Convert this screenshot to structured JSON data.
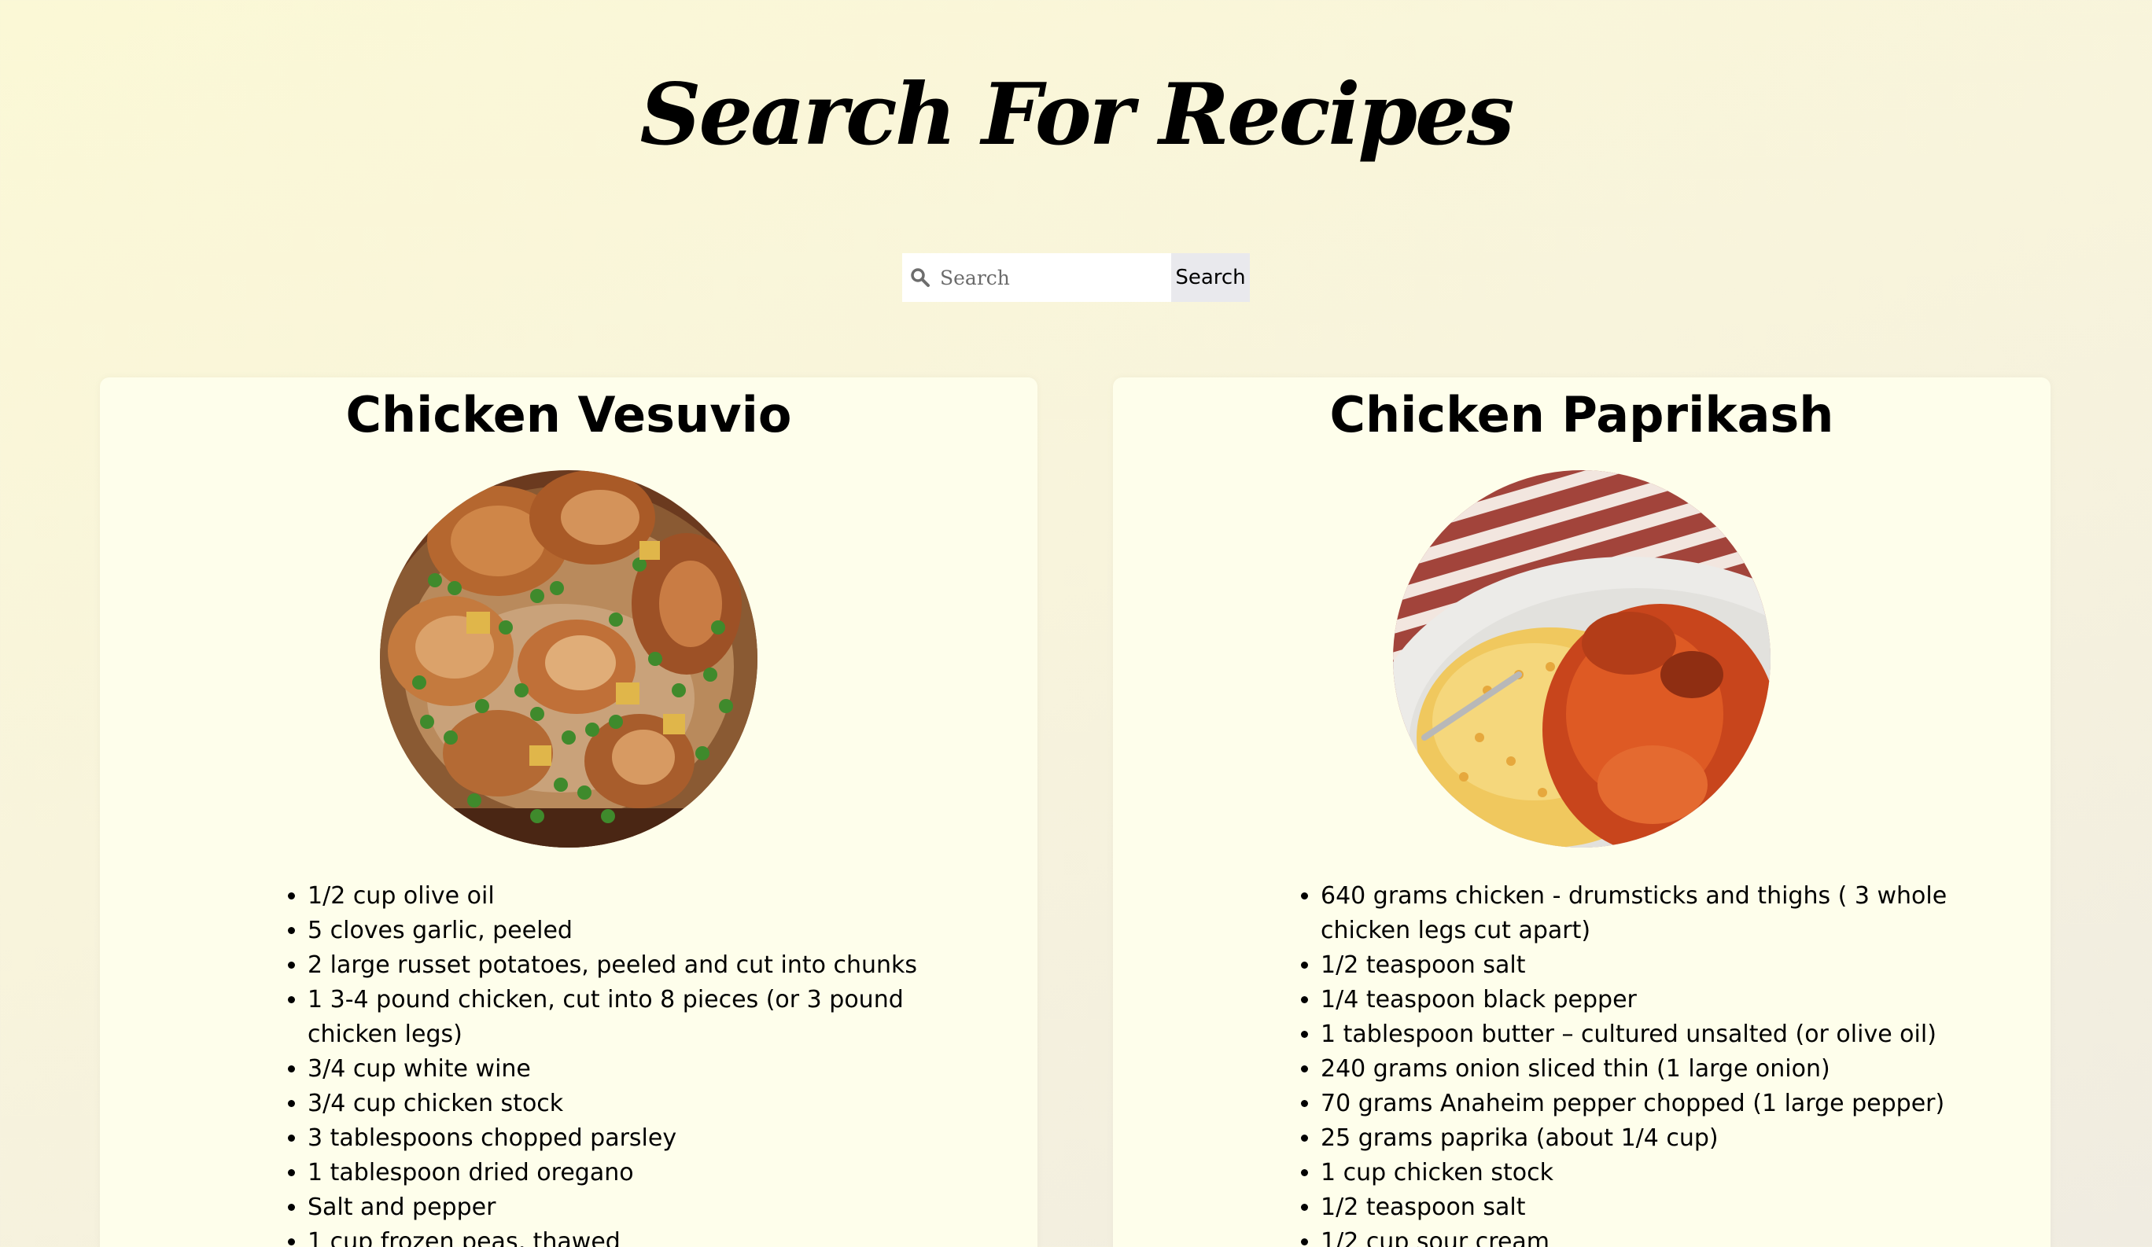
{
  "page": {
    "title": "Search For Recipes"
  },
  "search": {
    "placeholder": "Search",
    "value": "",
    "button_label": "Search",
    "icon": "search-icon"
  },
  "recipes": [
    {
      "title": "Chicken Vesuvio",
      "image": "chicken-vesuvio-photo",
      "ingredients": [
        "1/2 cup olive oil",
        "5 cloves garlic, peeled",
        "2 large russet potatoes, peeled and cut into chunks",
        "1 3-4 pound chicken, cut into 8 pieces (or 3 pound chicken legs)",
        "3/4 cup white wine",
        "3/4 cup chicken stock",
        "3 tablespoons chopped parsley",
        "1 tablespoon dried oregano",
        "Salt and pepper",
        "1 cup frozen peas, thawed"
      ]
    },
    {
      "title": "Chicken Paprikash",
      "image": "chicken-paprikash-photo",
      "ingredients": [
        "640 grams chicken - drumsticks and thighs ( 3 whole chicken legs cut apart)",
        "1/2 teaspoon salt",
        "1/4 teaspoon black pepper",
        "1 tablespoon butter – cultured unsalted (or olive oil)",
        "240 grams onion sliced thin (1 large onion)",
        "70 grams Anaheim pepper chopped (1 large pepper)",
        "25 grams paprika (about 1/4 cup)",
        "1 cup chicken stock",
        "1/2 teaspoon salt",
        "1/2 cup sour cream"
      ]
    }
  ]
}
